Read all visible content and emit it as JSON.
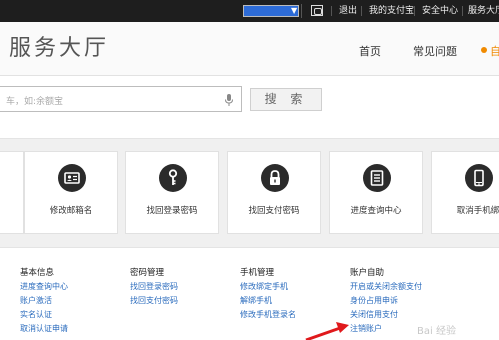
{
  "topbar": {
    "logout": "退出",
    "my_alipay": "我的支付宝",
    "security_center": "安全中心",
    "service_center": "服务大厅"
  },
  "header": {
    "title": "服务大厅",
    "nav": [
      "首页",
      "常见问题"
    ]
  },
  "search": {
    "placeholder": "车，如:余额宝",
    "button": "搜 索"
  },
  "services": [
    {
      "label": "修改邮箱名",
      "icon": "id-card-icon"
    },
    {
      "label": "找回登录密码",
      "icon": "key-icon"
    },
    {
      "label": "找回支付密码",
      "icon": "lock-icon"
    },
    {
      "label": "进度查询中心",
      "icon": "document-icon"
    },
    {
      "label": "取消手机绑",
      "icon": "phone-icon"
    }
  ],
  "link_columns": [
    {
      "title": "基本信息",
      "links": [
        "进度查询中心",
        "账户激活",
        "实名认证",
        "取消认证申请"
      ]
    },
    {
      "title": "密码管理",
      "links": [
        "找回登录密码",
        "找回支付密码"
      ]
    },
    {
      "title": "手机管理",
      "links": [
        "修改绑定手机",
        "解绑手机",
        "修改手机登录名"
      ]
    },
    {
      "title": "账户自助",
      "links": [
        "开启或关闭余额支付",
        "身份占用申诉",
        "关闭信用支付",
        "注销账户"
      ]
    }
  ],
  "annotation_color": "#e0191c",
  "accent_color": "#f08a00"
}
